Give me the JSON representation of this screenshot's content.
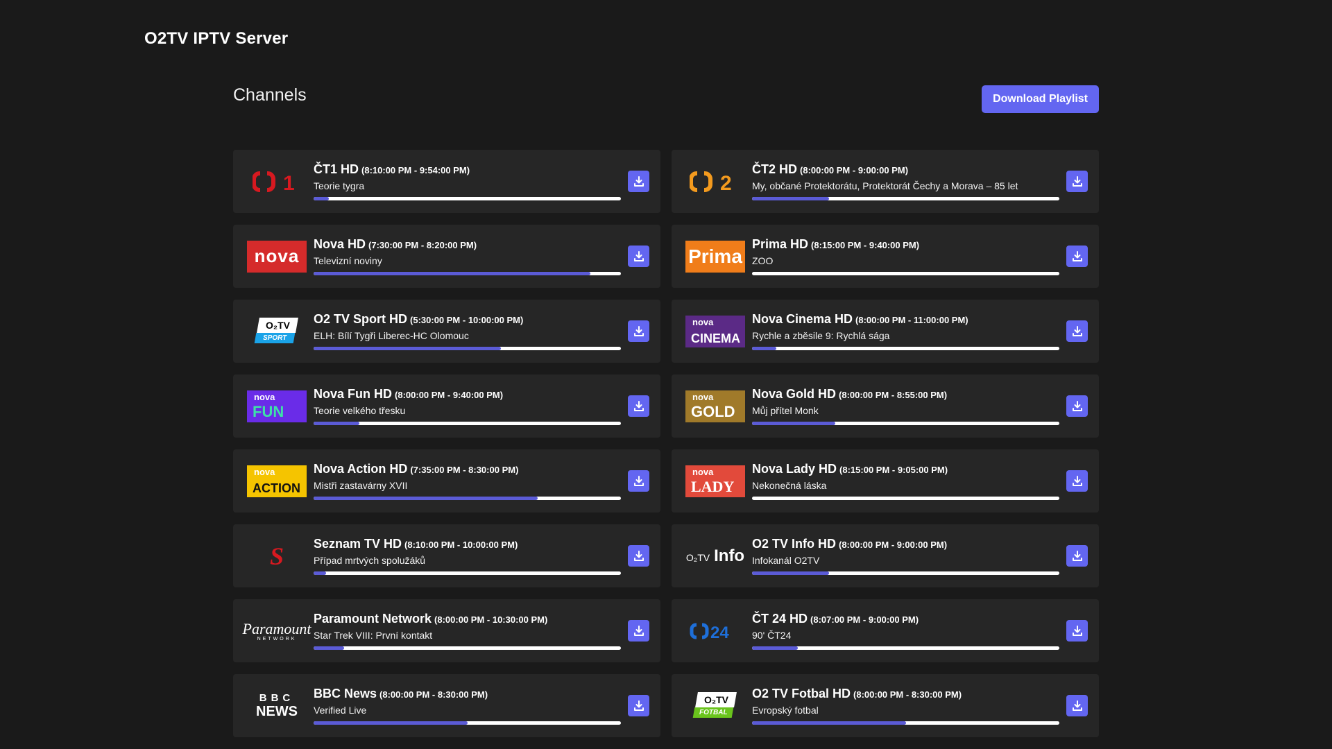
{
  "app": {
    "title": "O2TV IPTV Server"
  },
  "page": {
    "section_title": "Channels",
    "download_playlist_label": "Download Playlist"
  },
  "accent": "#6366f1",
  "channels": [
    {
      "name": "ČT1 HD",
      "time": "(8:10:00 PM - 9:54:00 PM)",
      "program": "Teorie tygra",
      "progress": 0.05,
      "logo": "ct1-logo"
    },
    {
      "name": "ČT2 HD",
      "time": "(8:00:00 PM - 9:00:00 PM)",
      "program": "My, občané Protektorátu, Protektorát Čechy a Morava – 85 let",
      "progress": 0.25,
      "logo": "ct2-logo"
    },
    {
      "name": "Nova HD",
      "time": "(7:30:00 PM - 8:20:00 PM)",
      "program": "Televizní noviny",
      "progress": 0.9,
      "logo": "nova-logo",
      "logo_text": "nova"
    },
    {
      "name": "Prima HD",
      "time": "(8:15:00 PM - 9:40:00 PM)",
      "program": "ZOO",
      "progress": 0.0,
      "logo": "prima-logo",
      "logo_text": "Prima"
    },
    {
      "name": "O2 TV Sport HD",
      "time": "(5:30:00 PM - 10:00:00 PM)",
      "program": "ELH: Bílí Tygři Liberec-HC Olomouc",
      "progress": 0.61,
      "logo": "o2tv-sport-logo",
      "logo_text": "O₂TV",
      "logo_sub": "SPORT"
    },
    {
      "name": "Nova Cinema HD",
      "time": "(8:00:00 PM - 11:00:00 PM)",
      "program": "Rychle a zběsile 9: Rychlá sága",
      "progress": 0.08,
      "logo": "nova-cinema-logo",
      "logo_text": "nova",
      "logo_sub": "CINEMA"
    },
    {
      "name": "Nova Fun HD",
      "time": "(8:00:00 PM - 9:40:00 PM)",
      "program": "Teorie velkého třesku",
      "progress": 0.15,
      "logo": "nova-fun-logo",
      "logo_text": "nova",
      "logo_sub": "FUN"
    },
    {
      "name": "Nova Gold HD",
      "time": "(8:00:00 PM - 8:55:00 PM)",
      "program": "Můj přítel Monk",
      "progress": 0.27,
      "logo": "nova-gold-logo",
      "logo_text": "nova",
      "logo_sub": "GOLD"
    },
    {
      "name": "Nova Action HD",
      "time": "(7:35:00 PM - 8:30:00 PM)",
      "program": "Mistři zastavárny XVII",
      "progress": 0.73,
      "logo": "nova-action-logo",
      "logo_text": "nova",
      "logo_sub": "ACTION"
    },
    {
      "name": "Nova Lady HD",
      "time": "(8:15:00 PM - 9:05:00 PM)",
      "program": "Nekonečná láska",
      "progress": 0.0,
      "logo": "nova-lady-logo",
      "logo_text": "nova",
      "logo_sub": "LADY"
    },
    {
      "name": "Seznam TV HD",
      "time": "(8:10:00 PM - 10:00:00 PM)",
      "program": "Případ mrtvých spolužáků",
      "progress": 0.04,
      "logo": "seznam-logo",
      "logo_text": "S"
    },
    {
      "name": "O2 TV Info HD",
      "time": "(8:00:00 PM - 9:00:00 PM)",
      "program": "Infokanál O2TV",
      "progress": 0.25,
      "logo": "o2tv-info-logo",
      "logo_text": "O₂TV",
      "logo_sub": "Info"
    },
    {
      "name": "Paramount Network",
      "time": "(8:00:00 PM - 10:30:00 PM)",
      "program": "Star Trek VIII: První kontakt",
      "progress": 0.1,
      "logo": "paramount-logo",
      "logo_text": "Paramount",
      "logo_sub": "NETWORK"
    },
    {
      "name": "ČT 24 HD",
      "time": "(8:07:00 PM - 9:00:00 PM)",
      "program": "90' ČT24",
      "progress": 0.15,
      "logo": "ct24-logo"
    },
    {
      "name": "BBC News",
      "time": "(8:00:00 PM - 8:30:00 PM)",
      "program": "Verified Live",
      "progress": 0.5,
      "logo": "bbc-news-logo",
      "logo_text": "BBC",
      "logo_sub": "NEWS"
    },
    {
      "name": "O2 TV Fotbal HD",
      "time": "(8:00:00 PM - 8:30:00 PM)",
      "program": "Evropský fotbal",
      "progress": 0.5,
      "logo": "o2tv-fotbal-logo",
      "logo_text": "O₂TV",
      "logo_sub": "FOTBAL"
    }
  ]
}
